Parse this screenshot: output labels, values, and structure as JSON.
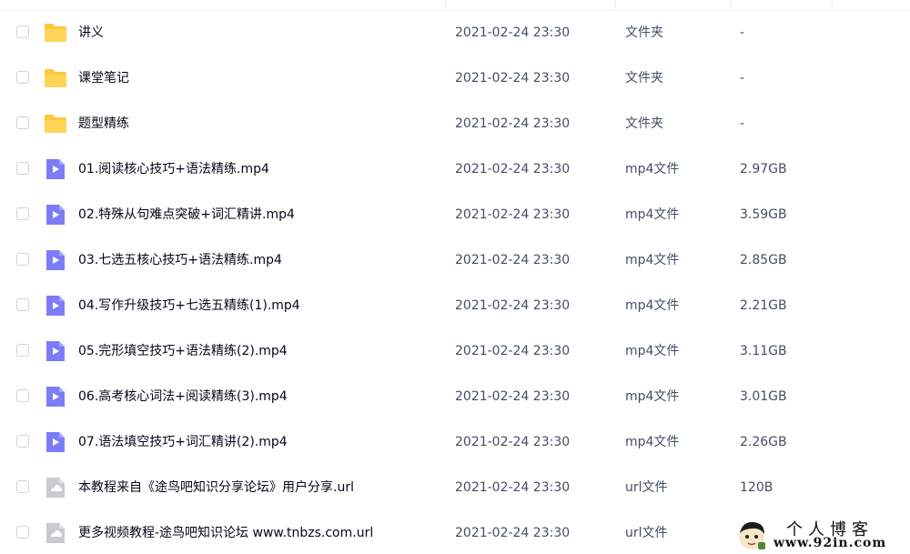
{
  "files": [
    {
      "name": "讲义",
      "time": "2021-02-24 23:30",
      "type": "文件夹",
      "size": "-",
      "icon": "folder-icon"
    },
    {
      "name": "课堂笔记",
      "time": "2021-02-24 23:30",
      "type": "文件夹",
      "size": "-",
      "icon": "folder-icon"
    },
    {
      "name": "题型精练",
      "time": "2021-02-24 23:30",
      "type": "文件夹",
      "size": "-",
      "icon": "folder-icon"
    },
    {
      "name": "01.阅读核心技巧+语法精练.mp4",
      "time": "2021-02-24 23:30",
      "type": "mp4文件",
      "size": "2.97GB",
      "icon": "video-file-icon"
    },
    {
      "name": "02.特殊从句难点突破+词汇精讲.mp4",
      "time": "2021-02-24 23:30",
      "type": "mp4文件",
      "size": "3.59GB",
      "icon": "video-file-icon"
    },
    {
      "name": "03.七选五核心技巧+语法精练.mp4",
      "time": "2021-02-24 23:30",
      "type": "mp4文件",
      "size": "2.85GB",
      "icon": "video-file-icon"
    },
    {
      "name": "04.写作升级技巧+七选五精练(1).mp4",
      "time": "2021-02-24 23:30",
      "type": "mp4文件",
      "size": "2.21GB",
      "icon": "video-file-icon"
    },
    {
      "name": "05.完形填空技巧+语法精练(2).mp4",
      "time": "2021-02-24 23:30",
      "type": "mp4文件",
      "size": "3.11GB",
      "icon": "video-file-icon"
    },
    {
      "name": "06.高考核心词法+阅读精练(3).mp4",
      "time": "2021-02-24 23:30",
      "type": "mp4文件",
      "size": "3.01GB",
      "icon": "video-file-icon"
    },
    {
      "name": "07.语法填空技巧+词汇精讲(2).mp4",
      "time": "2021-02-24 23:30",
      "type": "mp4文件",
      "size": "2.26GB",
      "icon": "video-file-icon"
    },
    {
      "name": "本教程来自《途鸟吧知识分享论坛》用户分享.url",
      "time": "2021-02-24 23:30",
      "type": "url文件",
      "size": "120B",
      "icon": "link-file-icon"
    },
    {
      "name": "更多视频教程-途鸟吧知识论坛 www.tnbzs.com.url",
      "time": "2021-02-24 23:30",
      "type": "url文件",
      "size": "",
      "icon": "link-file-icon"
    }
  ],
  "watermark": {
    "title": "个人博客",
    "url": "www.92in.com"
  },
  "colors": {
    "folder": "#fcc93b",
    "video": "#7c7cf8",
    "link": "#c8cbd2",
    "text_primary": "#03081a",
    "text_secondary": "#424e67"
  }
}
